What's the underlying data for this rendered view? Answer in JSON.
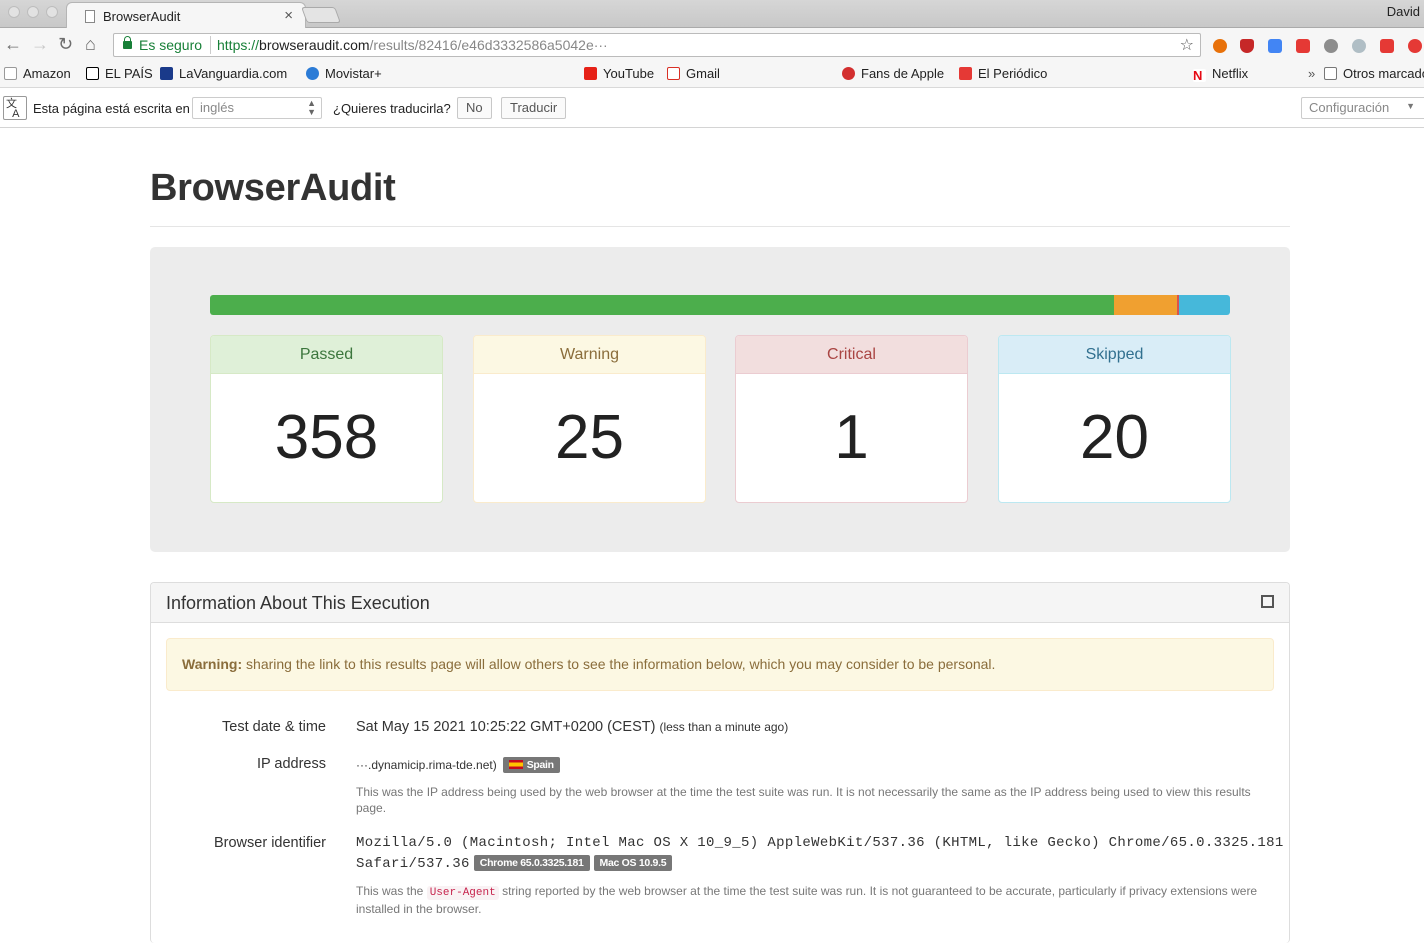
{
  "browser": {
    "tab_title": "BrowserAudit",
    "profile_name": "David",
    "secure_label": "Es seguro",
    "url_scheme": "https://",
    "url_host": "browseraudit.com",
    "url_path": "/results/82416/e46d3332586a5042e···"
  },
  "bookmarks": [
    {
      "label": "Amazon",
      "icon": "amazon-icon",
      "color": "#222222"
    },
    {
      "label": "EL PAÍS",
      "icon": "elpais-icon",
      "color": "#000000"
    },
    {
      "label": "LaVanguardia.com",
      "icon": "lavanguardia-icon",
      "color": "#1a3a8a"
    },
    {
      "label": "Movistar+",
      "icon": "movistar-icon",
      "color": "#2b7bd6"
    },
    {
      "label": "YouTube",
      "icon": "youtube-icon",
      "color": "#e62117"
    },
    {
      "label": "Gmail",
      "icon": "gmail-icon",
      "color": "#d93025"
    },
    {
      "label": "Fans de Apple",
      "icon": "apple-icon",
      "color": "#d32f2f"
    },
    {
      "label": "El Periódico",
      "icon": "elperiodico-icon",
      "color": "#e53935"
    },
    {
      "label": "Netflix",
      "icon": "netflix-icon",
      "color": "#e50914"
    },
    {
      "label": "Otros marcadores",
      "icon": "folder-icon",
      "color": "#777777"
    }
  ],
  "translate": {
    "prompt": "Esta página está escrita en",
    "language": "inglés",
    "question": "¿Quieres traducirla?",
    "no_label": "No",
    "translate_label": "Traducir",
    "config_label": "Configuración"
  },
  "page": {
    "title": "BrowserAudit"
  },
  "summary": {
    "passed_label": "Passed",
    "passed": 358,
    "warning_label": "Warning",
    "warning": 25,
    "critical_label": "Critical",
    "critical": 1,
    "skipped_label": "Skipped",
    "skipped": 20,
    "colors": {
      "passed": "#4cae4c",
      "warning": "#f0a030",
      "critical": "#d9534f",
      "skipped": "#46b8da"
    }
  },
  "execution": {
    "panel_title": "Information About This Execution",
    "warning_strong": "Warning:",
    "warning_text": "sharing the link to this results page will allow others to see the information below, which you may consider to be personal.",
    "date_label": "Test date & time",
    "date_value": "Sat May 15 2021 10:25:22 GMT+0200 (CEST)",
    "date_relative": "(less than a minute ago)",
    "ip_label": "IP address",
    "ip_value": "···.dynamicip.rima-tde.net)",
    "ip_country": "Spain",
    "ip_help": "This was the IP address being used by the web browser at the time the test suite was run. It is not necessarily the same as the IP address being used to view this results page.",
    "ua_label": "Browser identifier",
    "ua_line1": "Mozilla/5.0 (Macintosh; Intel Mac OS X 10_9_5) AppleWebKit/537.36 (KHTML, like Gecko) Chrome/65.0.3325.181",
    "ua_line2": "Safari/537.36",
    "ua_badge_browser": "Chrome 65.0.3325.181",
    "ua_badge_os": "Mac OS 10.9.5",
    "ua_help_before": "This was the",
    "ua_help_code": "User-Agent",
    "ua_help_after": "string reported by the web browser at the time the test suite was run. It is not guaranteed to be accurate, particularly if privacy extensions were installed in the browser."
  }
}
